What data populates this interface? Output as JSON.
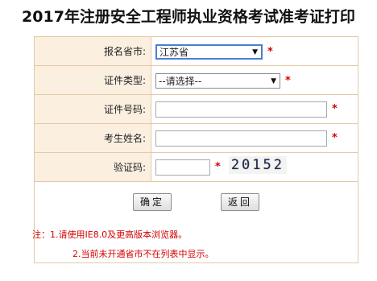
{
  "title": "2017年注册安全工程师执业资格考试准考证打印",
  "form": {
    "province_label": "报名省市:",
    "province_value": "江苏省",
    "id_type_label": "证件类型:",
    "id_type_value": "--请选择--",
    "id_number_label": "证件号码:",
    "name_label": "考生姓名:",
    "captcha_label": "验证码:",
    "captcha_text": "20152",
    "required_mark": "*"
  },
  "buttons": {
    "confirm": "确定",
    "back": "返回"
  },
  "notes": {
    "line1": "注：1.请使用IE8.0及更高版本浏览器。",
    "line2": "2.当前未开通省市不在列表中显示。"
  },
  "colors": {
    "label_bg": "#fbefe0",
    "border": "#e3c9a8",
    "required": "#d40000",
    "focus": "#4a7fd0"
  }
}
